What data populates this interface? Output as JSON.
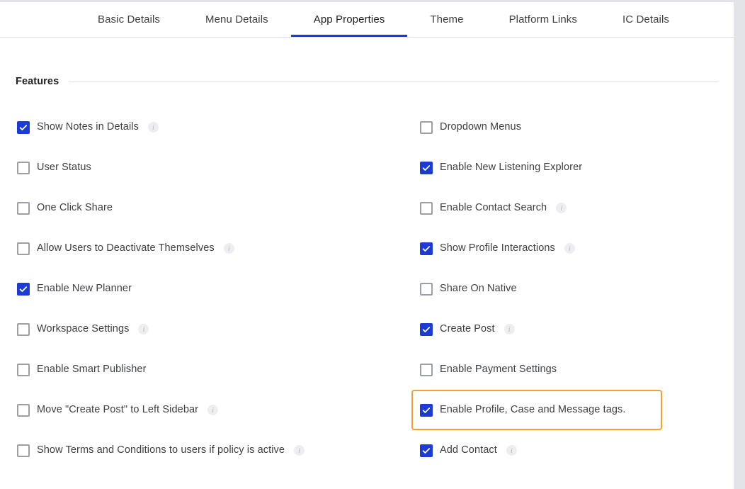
{
  "colors": {
    "accent": "#1b3bd4",
    "highlight": "#f5a132",
    "checkbox_border": "#9aa0a6",
    "text": "#3c4043",
    "rule": "#dcdde2"
  },
  "tabs": [
    {
      "label": "Basic Details",
      "active": false
    },
    {
      "label": "Menu Details",
      "active": false
    },
    {
      "label": "App Properties",
      "active": true
    },
    {
      "label": "Theme",
      "active": false
    },
    {
      "label": "Platform Links",
      "active": false
    },
    {
      "label": "IC Details",
      "active": false
    }
  ],
  "section": {
    "title": "Features"
  },
  "features": {
    "left": [
      {
        "label": "Show Notes in Details",
        "checked": true,
        "info": true,
        "highlighted": false
      },
      {
        "label": "User Status",
        "checked": false,
        "info": false,
        "highlighted": false
      },
      {
        "label": "One Click Share",
        "checked": false,
        "info": false,
        "highlighted": false
      },
      {
        "label": "Allow Users to Deactivate Themselves",
        "checked": false,
        "info": true,
        "highlighted": false
      },
      {
        "label": "Enable New Planner",
        "checked": true,
        "info": false,
        "highlighted": false
      },
      {
        "label": "Workspace Settings",
        "checked": false,
        "info": true,
        "highlighted": false
      },
      {
        "label": "Enable Smart Publisher",
        "checked": false,
        "info": false,
        "highlighted": false
      },
      {
        "label": "Move \"Create Post\" to Left Sidebar",
        "checked": false,
        "info": true,
        "highlighted": false
      },
      {
        "label": "Show Terms and Conditions to users if policy is active",
        "checked": false,
        "info": true,
        "highlighted": false
      }
    ],
    "right": [
      {
        "label": "Dropdown Menus",
        "checked": false,
        "info": false,
        "highlighted": false
      },
      {
        "label": "Enable New Listening Explorer",
        "checked": true,
        "info": false,
        "highlighted": false
      },
      {
        "label": "Enable Contact Search",
        "checked": false,
        "info": true,
        "highlighted": false
      },
      {
        "label": "Show Profile Interactions",
        "checked": true,
        "info": true,
        "highlighted": false
      },
      {
        "label": "Share On Native",
        "checked": false,
        "info": false,
        "highlighted": false
      },
      {
        "label": "Create Post",
        "checked": true,
        "info": true,
        "highlighted": false
      },
      {
        "label": "Enable Payment Settings",
        "checked": false,
        "info": false,
        "highlighted": false
      },
      {
        "label": "Enable Profile, Case and Message tags.",
        "checked": true,
        "info": false,
        "highlighted": true
      },
      {
        "label": "Add Contact",
        "checked": true,
        "info": true,
        "highlighted": false
      }
    ]
  },
  "icons": {
    "info": "info-icon",
    "check": "check-icon"
  }
}
